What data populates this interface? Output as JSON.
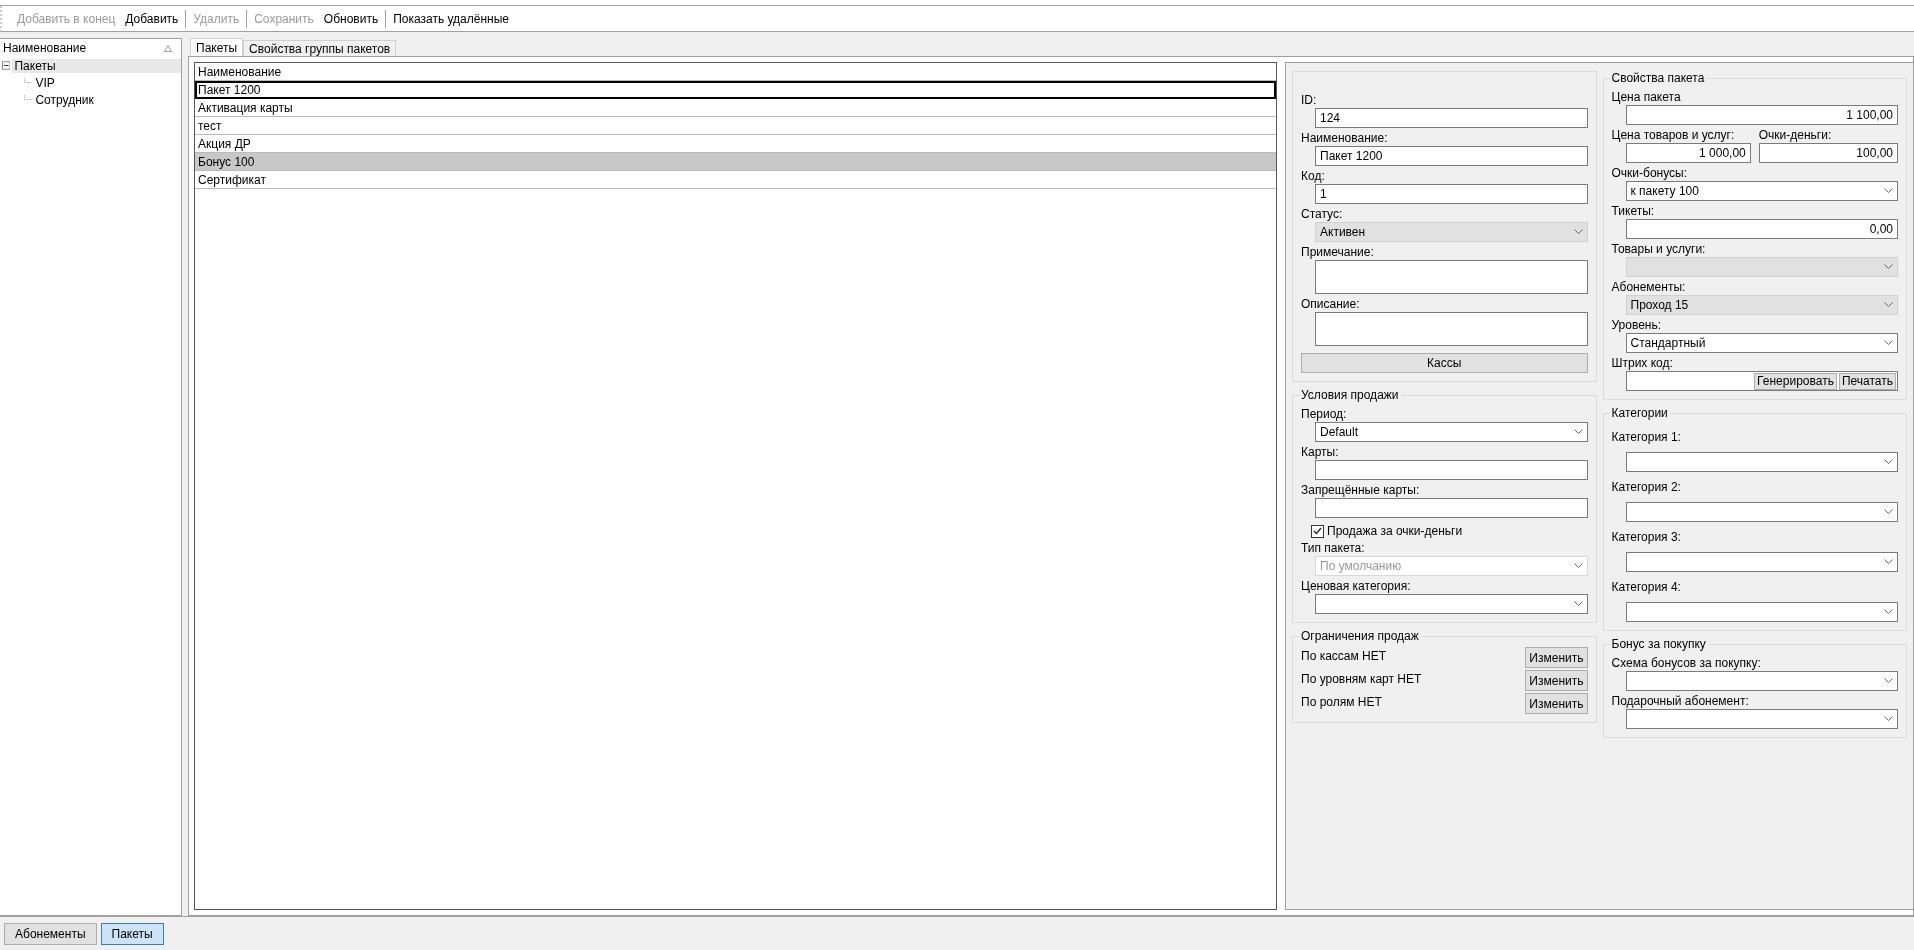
{
  "toolbar": {
    "groups": [
      [
        {
          "label": "Добавить в конец",
          "disabled": true
        },
        {
          "label": "Добавить",
          "disabled": false
        }
      ],
      [
        {
          "label": "Удалить",
          "disabled": true
        }
      ],
      [
        {
          "label": "Сохранить",
          "disabled": true
        },
        {
          "label": "Обновить",
          "disabled": false
        }
      ],
      [
        {
          "label": "Показать удалённые",
          "disabled": false
        }
      ]
    ]
  },
  "tree": {
    "header": "Наименование",
    "items": [
      {
        "label": "Пакеты",
        "expanded": true,
        "selected": true,
        "children": [
          {
            "label": "VIP",
            "selected": false
          },
          {
            "label": "Сотрудник",
            "selected": false
          }
        ]
      }
    ]
  },
  "tabs": [
    {
      "label": "Пакеты",
      "selected": true
    },
    {
      "label": "Свойства группы пакетов",
      "selected": false
    }
  ],
  "list": {
    "column": "Наименование",
    "rows": [
      {
        "name": "Пакет 1200",
        "selected": false,
        "focused": true
      },
      {
        "name": "Активация карты",
        "selected": false,
        "focused": false
      },
      {
        "name": "тест",
        "selected": false,
        "focused": false
      },
      {
        "name": "Акция ДР",
        "selected": false,
        "focused": false
      },
      {
        "name": "Бонус 100",
        "selected": true,
        "focused": false
      },
      {
        "name": "Сертификат",
        "selected": false,
        "focused": false
      }
    ]
  },
  "form": {
    "columns": [
      {
        "groups": [
          {
            "fields": [
              {
                "kind": "text",
                "label": "ID:",
                "value": "124"
              },
              {
                "kind": "text",
                "label": "Наименование:",
                "value": "Пакет 1200"
              },
              {
                "kind": "text",
                "label": "Код:",
                "value": "1"
              },
              {
                "kind": "combo",
                "label": "Статус:",
                "value": "Активен",
                "readonly": true,
                "disabled": false
              },
              {
                "kind": "textarea",
                "label": "Примечание:"
              },
              {
                "kind": "textarea",
                "label": "Описание:"
              },
              {
                "kind": "button",
                "label": "Кассы"
              }
            ]
          },
          {
            "title": "Условия продажи",
            "fields": [
              {
                "kind": "combo",
                "label": "Период:",
                "value": "Default",
                "readonly": false,
                "disabled": false
              },
              {
                "kind": "text",
                "label": "Карты:"
              },
              {
                "kind": "text",
                "label": "Запрещённые карты:"
              },
              {
                "kind": "checkbox",
                "label": "Продажа за очки-деньги",
                "checked": true
              },
              {
                "kind": "combo",
                "label": "Тип пакета:",
                "value": "По умолчанию",
                "readonly": false,
                "disabled": true
              },
              {
                "kind": "combo",
                "label": "Ценовая категория:",
                "readonly": false,
                "disabled": false
              }
            ]
          },
          {
            "title": "Ограничения продаж",
            "fields": [
              {
                "kind": "limit",
                "label": "По кассам НЕТ",
                "button": "Изменить"
              },
              {
                "kind": "limit",
                "label": "По уровням карт НЕТ",
                "button": "Изменить"
              },
              {
                "kind": "limit",
                "label": "По ролям НЕТ",
                "button": "Изменить"
              }
            ]
          }
        ]
      },
      {
        "groups": [
          {
            "title": "Свойства пакета",
            "fields": [
              {
                "kind": "number",
                "label": "Цена пакета",
                "value": "1 100,00"
              },
              {
                "kind": "pair",
                "items": [
                  {
                    "label": "Цена товаров и услуг:",
                    "value": "1 000,00"
                  },
                  {
                    "label": "Очки-деньги:",
                    "value": "100,00"
                  }
                ]
              },
              {
                "kind": "combo",
                "label": "Очки-бонусы:",
                "value": "к пакету 100",
                "readonly": false,
                "disabled": false
              },
              {
                "kind": "number",
                "label": "Тикеты:",
                "value": "0,00"
              },
              {
                "kind": "combo",
                "label": "Товары и услуги:",
                "readonly": true,
                "disabled": false
              },
              {
                "kind": "combo",
                "label": "Абонементы:",
                "value": "Проход 15",
                "readonly": true,
                "disabled": false
              },
              {
                "kind": "combo",
                "label": "Уровень:",
                "value": "Стандартный",
                "readonly": false,
                "disabled": false
              },
              {
                "kind": "barcode",
                "label": "Штрих код:",
                "buttons": [
                  "Генерировать",
                  "Печатать"
                ]
              }
            ]
          },
          {
            "title": "Категории",
            "fields": [
              {
                "kind": "category",
                "label": "Категория 1:"
              },
              {
                "kind": "category",
                "label": "Категория 2:"
              },
              {
                "kind": "category",
                "label": "Категория 3:"
              },
              {
                "kind": "category",
                "label": "Категория 4:"
              }
            ]
          },
          {
            "title": "Бонус за покупку",
            "fields": [
              {
                "kind": "combo",
                "label": "Схема бонусов за покупку:",
                "readonly": false,
                "disabled": false
              },
              {
                "kind": "combo",
                "label": "Подарочный абонемент:",
                "readonly": false,
                "disabled": false
              }
            ]
          }
        ]
      }
    ]
  },
  "bottom_tabs": [
    {
      "label": "Абонементы",
      "selected": false
    },
    {
      "label": "Пакеты",
      "selected": true
    }
  ]
}
